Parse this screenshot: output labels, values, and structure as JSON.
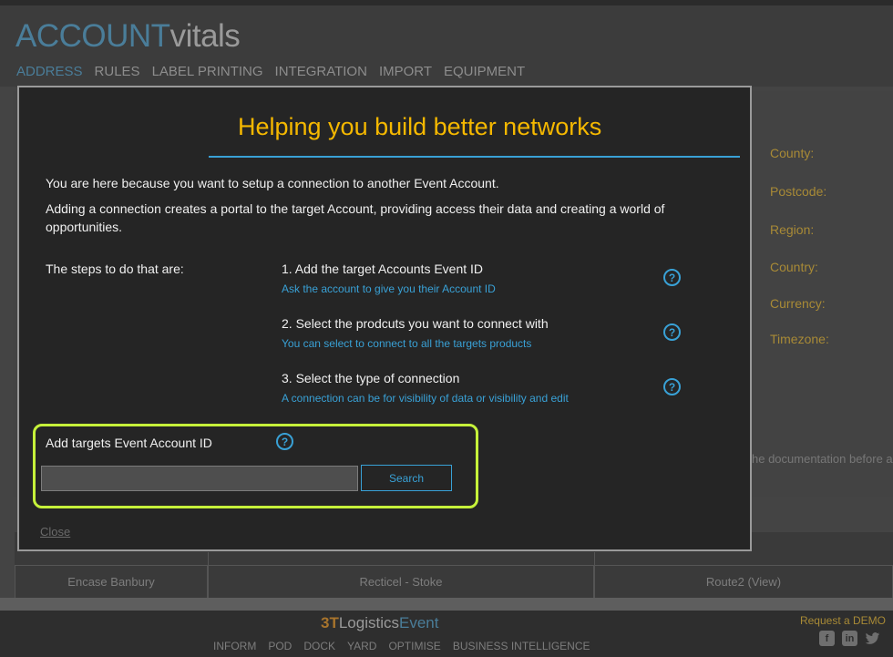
{
  "app": {
    "brand_part1": "ACCOUNT",
    "brand_part2": "vitals",
    "nav": [
      "ADDRESS",
      "RULES",
      "LABEL PRINTING",
      "INTEGRATION",
      "IMPORT",
      "EQUIPMENT"
    ],
    "active_nav": "ADDRESS",
    "side_labels": [
      "County:",
      "Postcode:",
      "Region:",
      "Country:",
      "Currency:",
      "Timezone:"
    ],
    "doc_text": "he documentation before a",
    "table_cells": [
      "Encase Banbury",
      "Recticel - Stoke",
      "Route2 (View)"
    ]
  },
  "footer": {
    "logo_prefix": "3T",
    "logo_main": "Logistics",
    "logo_accent": "Event",
    "nav": [
      "INFORM",
      "POD",
      "DOCK",
      "YARD",
      "OPTIMISE",
      "BUSINESS INTELLIGENCE"
    ],
    "demo_link": "Request a DEMO",
    "social_icons": [
      "facebook-icon",
      "linkedin-icon",
      "twitter-icon"
    ]
  },
  "modal": {
    "title": "Helping you build better networks",
    "intro1": "You are here because you want to setup a connection to another Event Account.",
    "intro2": "Adding a connection creates a portal to the target Account, providing access their data and creating a world of opportunities.",
    "steps_label": "The steps to do that are:",
    "steps": [
      {
        "title": "1. Add the target Accounts Event ID",
        "subtitle": "Ask the account to give you their Account ID"
      },
      {
        "title": "2. Select the prodcuts you want to connect with",
        "subtitle": "You can select to connect to all the targets products"
      },
      {
        "title": "3. Select the type of connection",
        "subtitle": "A connection can be for visibility of data or visibility and edit"
      }
    ],
    "help_glyph": "?",
    "add_label": "Add targets Event Account ID",
    "input_value": "",
    "input_placeholder": "",
    "search_label": "Search",
    "close_label": "Close"
  },
  "colors": {
    "accent_blue": "#39a1d6",
    "title_gold": "#f5b800",
    "highlight_green": "#c6f23a",
    "label_gold": "#a88a36"
  }
}
